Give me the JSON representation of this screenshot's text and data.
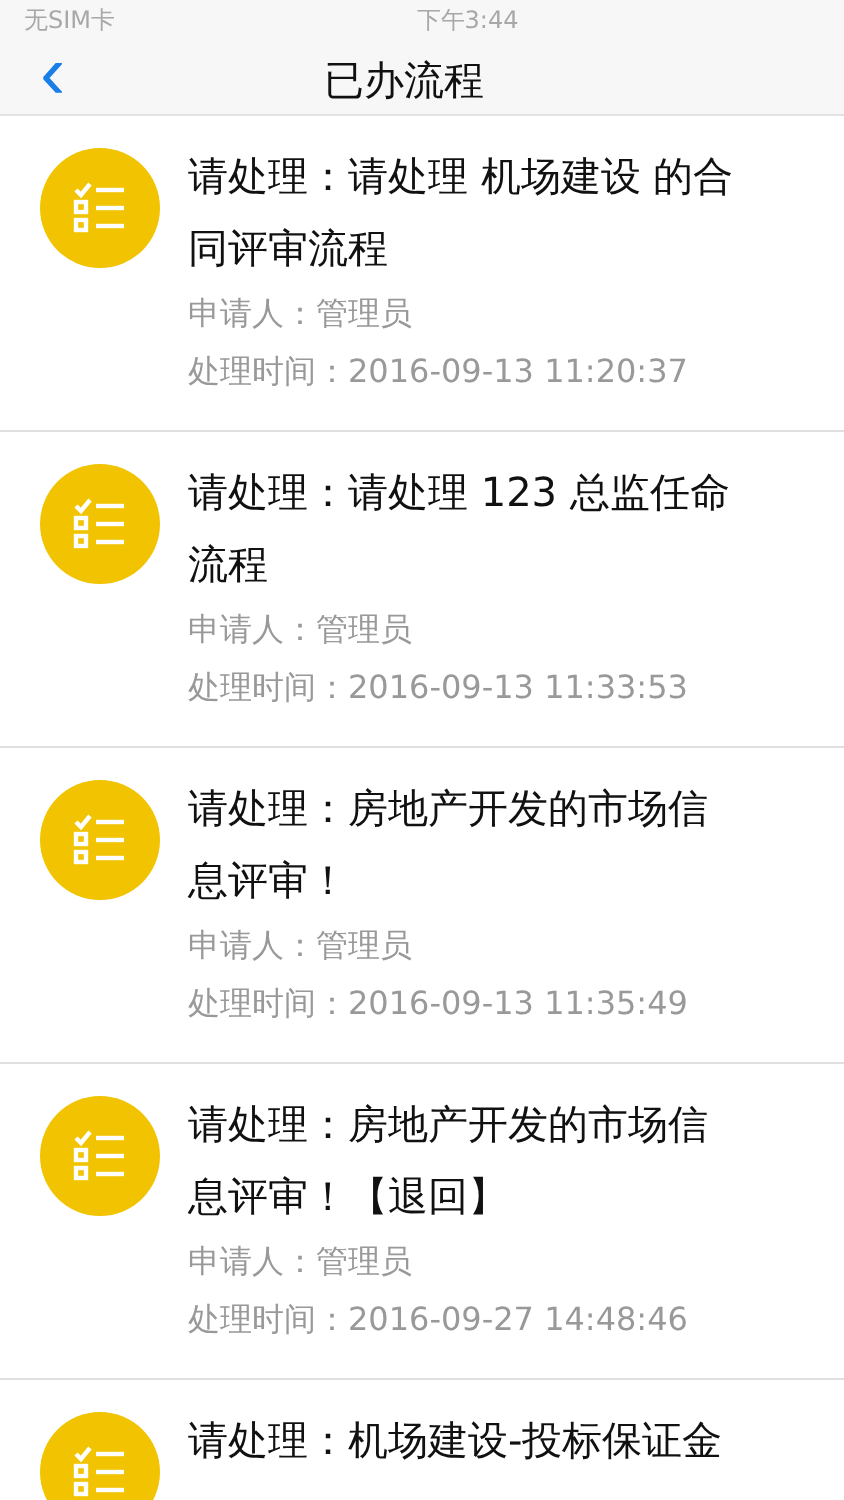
{
  "status_bar": {
    "carrier": "无SIM卡",
    "time": "下午3:44"
  },
  "nav": {
    "back": "‹",
    "title": "已办流程"
  },
  "items": [
    {
      "title_lines": [
        "请处理：请处理 机场建设 的合",
        "同评审流程"
      ],
      "applicant": "申请人：管理员",
      "time": "处理时间：2016-09-13 11:20:37"
    },
    {
      "title_lines": [
        "请处理：请处理 123 总监任命",
        "流程"
      ],
      "applicant": "申请人：管理员",
      "time": "处理时间：2016-09-13 11:33:53"
    },
    {
      "title_lines": [
        "请处理：房地产开发的市场信",
        "息评审！"
      ],
      "applicant": "申请人：管理员",
      "time": "处理时间：2016-09-13 11:35:49"
    },
    {
      "title_lines": [
        "请处理：房地产开发的市场信",
        "息评审！【退回】"
      ],
      "applicant": "申请人：管理员",
      "time": "处理时间：2016-09-27 14:48:46"
    },
    {
      "title_lines": [
        "请处理：机场建设-投标保证金"
      ]
    }
  ]
}
